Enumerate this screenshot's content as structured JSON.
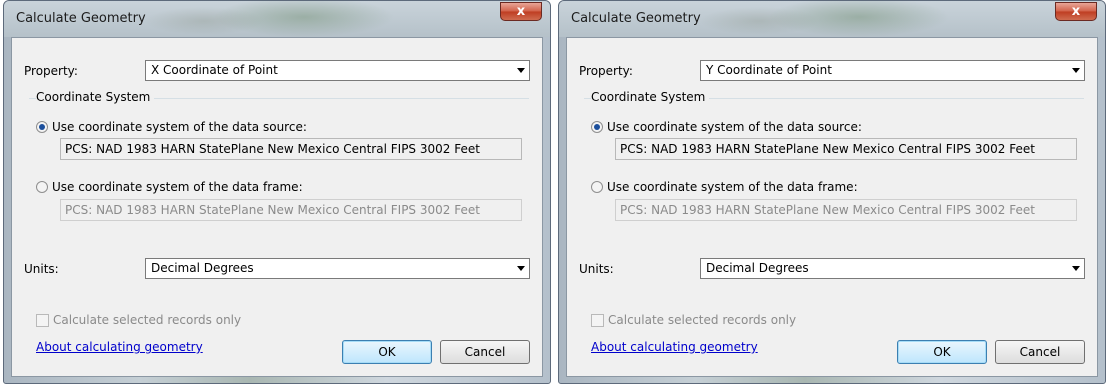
{
  "dialogs": [
    {
      "title": "Calculate Geometry",
      "close_label": "x",
      "property_label": "Property:",
      "property_value": "X Coordinate of Point",
      "coord_group_label": "Coordinate System",
      "radio_source_label": "Use coordinate system of the data source:",
      "source_cs_value": "PCS: NAD 1983 HARN StatePlane New Mexico Central FIPS 3002 Feet",
      "radio_frame_label": "Use coordinate system of the data frame:",
      "frame_cs_value": "PCS: NAD 1983 HARN StatePlane New Mexico Central FIPS 3002 Feet",
      "units_label": "Units:",
      "units_value": "Decimal Degrees",
      "selected_only_label": "Calculate selected records only",
      "about_link": "About calculating geometry",
      "ok_label": "OK",
      "cancel_label": "Cancel"
    },
    {
      "title": "Calculate Geometry",
      "close_label": "x",
      "property_label": "Property:",
      "property_value": "Y Coordinate of Point",
      "coord_group_label": "Coordinate System",
      "radio_source_label": "Use coordinate system of the data source:",
      "source_cs_value": "PCS: NAD 1983 HARN StatePlane New Mexico Central FIPS 3002 Feet",
      "radio_frame_label": "Use coordinate system of the data frame:",
      "frame_cs_value": "PCS: NAD 1983 HARN StatePlane New Mexico Central FIPS 3002 Feet",
      "units_label": "Units:",
      "units_value": "Decimal Degrees",
      "selected_only_label": "Calculate selected records only",
      "about_link": "About calculating geometry",
      "ok_label": "OK",
      "cancel_label": "Cancel"
    }
  ],
  "colors": {
    "link": "#0000cc",
    "radio_selected": "#1c4f9c",
    "close_button": "#c9452a",
    "ok_button_accent": "#3c7fb1"
  },
  "icons": {
    "dropdown": "chevron-down-icon",
    "close": "close-icon"
  }
}
